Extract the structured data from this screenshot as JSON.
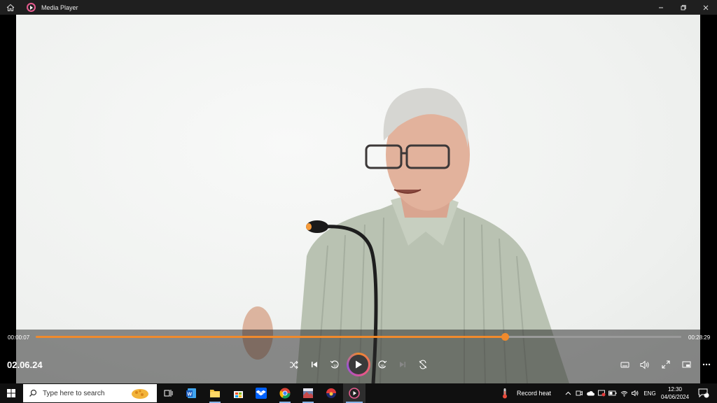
{
  "window": {
    "title": "Media Player"
  },
  "player": {
    "elapsed": "00:00:07",
    "duration": "00:28:29",
    "progress_fraction": 0.727,
    "video_title": "02.06.24",
    "accent": "#f08a2c"
  },
  "taskbar": {
    "search_placeholder": "Type here to search",
    "weather_text": "Record heat",
    "language": "ENG",
    "time": "12:30",
    "date": "04/06/2024",
    "notification_count": "2"
  },
  "icons": {
    "home": "home-icon",
    "shuffle": "shuffle-icon",
    "previous": "skip-previous-icon",
    "rewind": "rewind-10-icon",
    "play": "play-icon",
    "forward": "forward-30-icon",
    "next": "skip-next-icon",
    "repeat": "repeat-icon",
    "miniplayer": "miniplayer-icon",
    "volume": "volume-icon",
    "fullscreen": "fullscreen-icon",
    "cast": "cast-icon",
    "more": "more-icon"
  }
}
